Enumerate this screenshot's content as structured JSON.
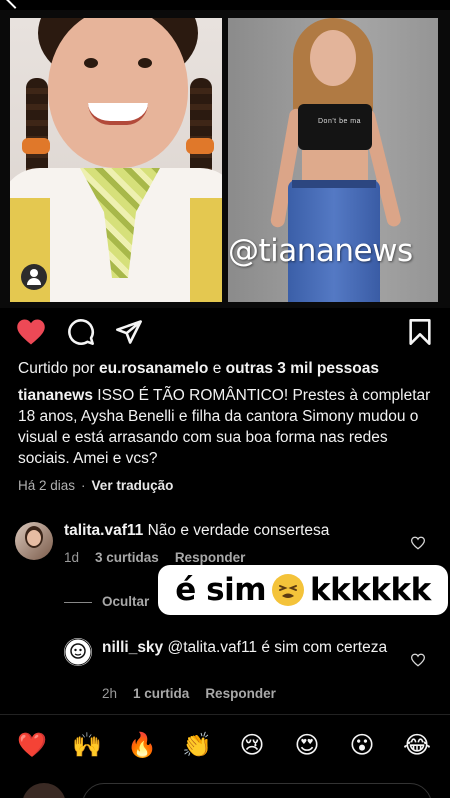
{
  "post": {
    "watermark": "@tiananews",
    "teen_shirt_text": "Don't be ma"
  },
  "likes": {
    "prefix": "Curtido por ",
    "user": "eu.rosanamelo",
    "joiner": " e ",
    "others": "outras 3 mil pessoas"
  },
  "caption": {
    "username": "tiananews",
    "text": " ISSO É TÃO ROMÂNTICO!  Prestes à completar 18 anos, Aysha Benelli e filha da cantora Simony mudou o visual e está arrasando com sua boa forma nas redes sociais. Amei e vcs?"
  },
  "meta": {
    "time": "Há 2 dias",
    "separator": "·",
    "translate": "Ver tradução"
  },
  "comments": [
    {
      "username": "talita.vaf11",
      "text": " Não e verdade consertesa",
      "time": "1d",
      "likes": "3 curtidas",
      "reply": "Responder"
    },
    {
      "username": "nilli_sky",
      "text": " @talita.vaf11  é sim com certeza",
      "time": "2h",
      "likes": "1 curtida",
      "reply": "Responder"
    }
  ],
  "hide_replies": "Ocultar",
  "sticker": {
    "part1": "é sim",
    "part2": "kkkkkk"
  },
  "emoji_bar": [
    "❤️",
    "🙌",
    "🔥",
    "👏",
    "😢",
    "😍",
    "😮",
    "😂"
  ],
  "colors": {
    "background": "#000000",
    "like_red": "#ed4956",
    "text": "#f2f2f2",
    "muted": "#9a9a9a"
  }
}
